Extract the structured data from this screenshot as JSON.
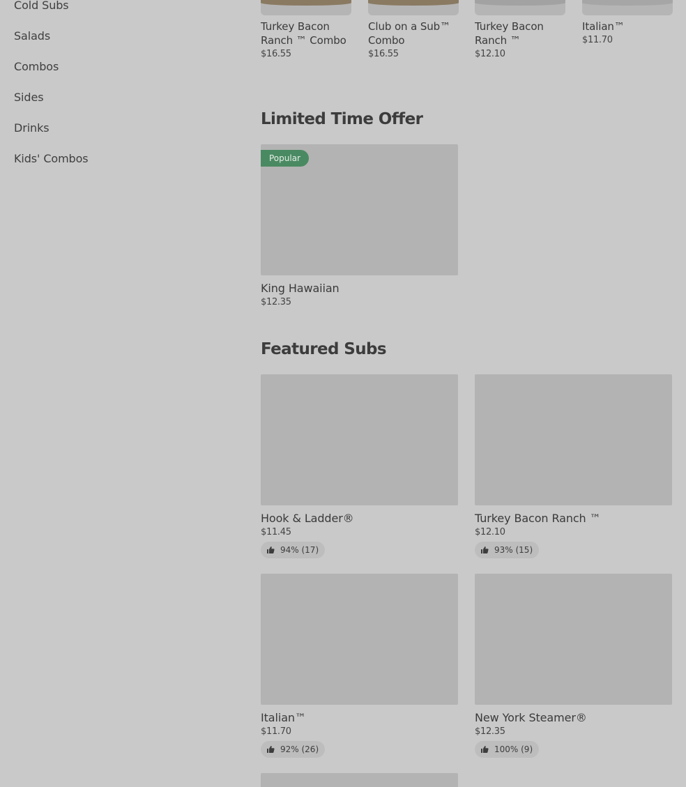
{
  "sidebar": {
    "items": [
      {
        "label": "Cold Subs"
      },
      {
        "label": "Salads"
      },
      {
        "label": "Combos"
      },
      {
        "label": "Sides"
      },
      {
        "label": "Drinks"
      },
      {
        "label": "Kids' Combos"
      }
    ]
  },
  "top_row": {
    "cards": [
      {
        "name": "Turkey Bacon Ranch ™ Combo",
        "price": "$16.55",
        "food_color": "#8a7a62"
      },
      {
        "name": "Club on a Sub™ Combo",
        "price": "$16.55",
        "food_color": "#8a7a62"
      },
      {
        "name": "Turkey Bacon Ranch ™",
        "price": "$12.10",
        "food_color": "#a2a2a2"
      },
      {
        "name": "Italian™",
        "price": "$11.70",
        "food_color": "#a6a6a6"
      }
    ]
  },
  "limited": {
    "title": "Limited Time Offer",
    "card": {
      "badge": "Popular",
      "name": "King Hawaiian",
      "price": "$12.35"
    }
  },
  "featured": {
    "title": "Featured Subs",
    "cards": [
      {
        "name": "Hook & Ladder®",
        "price": "$11.45",
        "rating": "94% (17)"
      },
      {
        "name": "Turkey Bacon Ranch ™",
        "price": "$12.10",
        "rating": "93% (15)"
      },
      {
        "name": "Italian™",
        "price": "$11.70",
        "rating": "92% (26)"
      },
      {
        "name": "New York Steamer®",
        "price": "$12.35",
        "rating": "100% (9)"
      }
    ]
  },
  "colors": {
    "background": "#c9c9c9",
    "badge": "#4a8a62",
    "image_placeholder": "#b3b3b3"
  }
}
